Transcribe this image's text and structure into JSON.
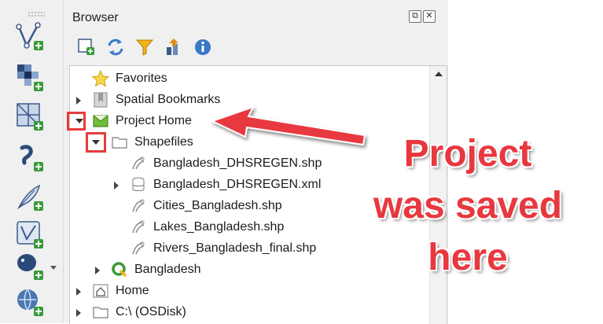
{
  "panel": {
    "title": "Browser",
    "float_button": "⧉",
    "close_button": "✕"
  },
  "tree": {
    "items": [
      {
        "label": "Favorites",
        "icon": "star-icon"
      },
      {
        "label": "Spatial Bookmarks",
        "icon": "bookmark-icon"
      },
      {
        "label": "Project Home",
        "icon": "project-home-icon"
      },
      {
        "label": "Shapefiles",
        "icon": "folder-icon"
      },
      {
        "label": "Bangladesh_DHSREGEN.shp",
        "icon": "polygon-layer-icon"
      },
      {
        "label": "Bangladesh_DHSREGEN.xml",
        "icon": "database-icon"
      },
      {
        "label": "Cities_Bangladesh.shp",
        "icon": "polygon-layer-icon"
      },
      {
        "label": "Lakes_Bangladesh.shp",
        "icon": "polygon-layer-icon"
      },
      {
        "label": "Rivers_Bangladesh_final.shp",
        "icon": "polygon-layer-icon"
      },
      {
        "label": "Bangladesh",
        "icon": "qgis-project-icon"
      },
      {
        "label": "Home",
        "icon": "home-folder-icon"
      },
      {
        "label": "C:\\ (OSDisk)",
        "icon": "drive-icon"
      }
    ]
  },
  "annotation": {
    "line1": "Project",
    "line2": "was saved",
    "line3": "here",
    "color": "#e8383f"
  }
}
